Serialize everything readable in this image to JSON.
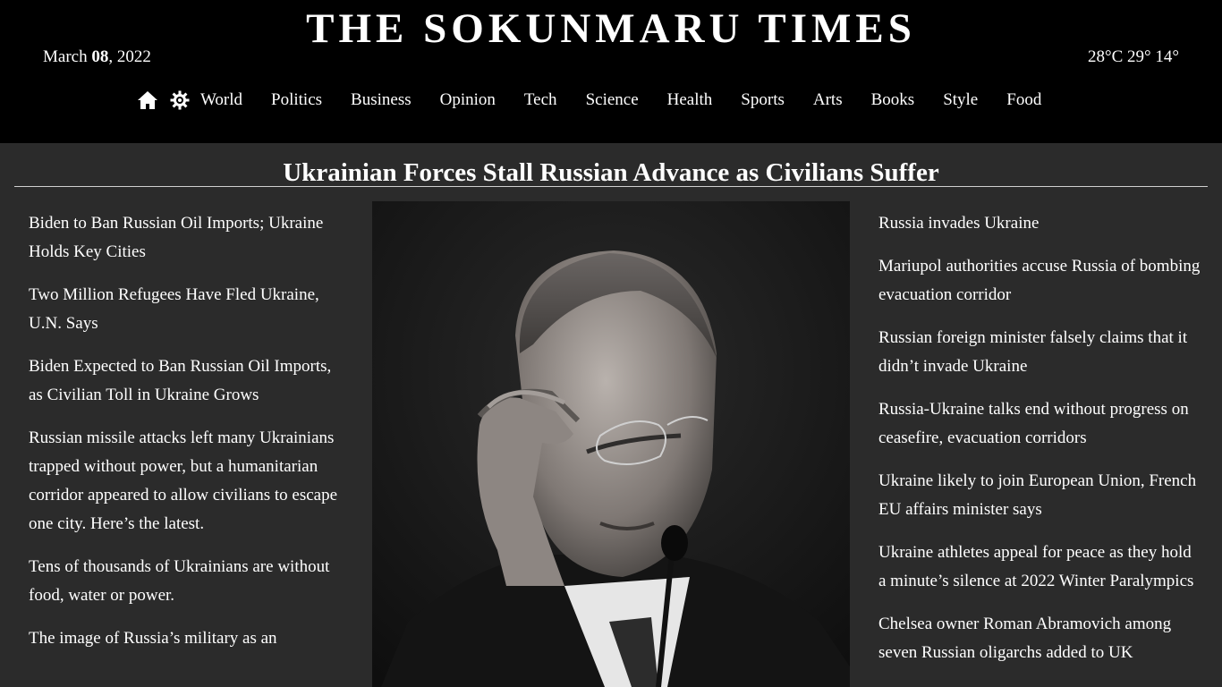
{
  "header": {
    "site_title": "THE SOKUNMARU TIMES",
    "date_prefix": "March ",
    "date_day": "08",
    "date_suffix": ", 2022",
    "weather": "28°C 29° 14°"
  },
  "nav": {
    "home_icon": "home-icon",
    "settings_icon": "gear-icon",
    "items": [
      "World",
      "Politics",
      "Business",
      "Opinion",
      "Tech",
      "Science",
      "Health",
      "Sports",
      "Arts",
      "Books",
      "Style",
      "Food"
    ]
  },
  "main": {
    "headline": "Ukrainian Forces Stall Russian Advance as Civilians Suffer",
    "left_stories": [
      "Biden to Ban Russian Oil Imports; Ukraine Holds Key Cities",
      "Two Million Refugees Have Fled Ukraine, U.N. Says",
      "Biden Expected to Ban Russian Oil Imports, as Civilian Toll in Ukraine Grows",
      "Russian missile attacks left many Ukrainians trapped without power, but a humanitarian corridor appeared to allow civilians to escape one city. Here’s the latest.",
      "Tens of thousands of Ukrainians are without food, water or power.",
      "The image of Russia’s military as an"
    ],
    "right_stories": [
      "Russia invades Ukraine",
      "Mariupol authorities accuse Russia of bombing evacuation corridor",
      "Russian foreign minister falsely claims that it didn’t invade Ukraine",
      "Russia-Ukraine talks end without progress on ceasefire, evacuation corridors",
      "Ukraine likely to join European Union, French EU affairs minister says",
      "Ukraine athletes appeal for peace as they hold a minute’s silence at 2022 Winter Paralympics",
      "Chelsea owner Roman Abramovich among seven Russian oligarchs added to UK"
    ]
  },
  "colors": {
    "masthead_bg": "#000000",
    "page_bg": "#2b2b2b",
    "text": "#ffffff"
  }
}
